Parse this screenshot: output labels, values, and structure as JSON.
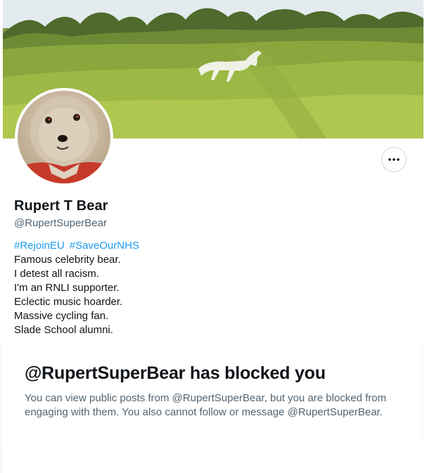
{
  "profile": {
    "display_name": "Rupert T Bear",
    "handle": "@RupertSuperBear",
    "hashtags": [
      "#RejoinEU",
      "#SaveOurNHS"
    ],
    "bio_lines": [
      "Famous celebrity bear.",
      "I detest all racism.",
      "I'm an RNLI supporter.",
      "Eclectic music hoarder.",
      "Massive cycling fan.",
      "Slade School alumni."
    ]
  },
  "actions": {
    "more_icon": "more-horizontal-icon"
  },
  "blocked": {
    "title": "@RupertSuperBear has blocked you",
    "message": "You can view public posts from @RupertSuperBear, but you are blocked from engaging with them. You also cannot follow or message @RupertSuperBear."
  },
  "colors": {
    "link": "#1d9bf0",
    "text": "#0f1419",
    "secondary": "#536471",
    "border": "#cfd9de"
  }
}
